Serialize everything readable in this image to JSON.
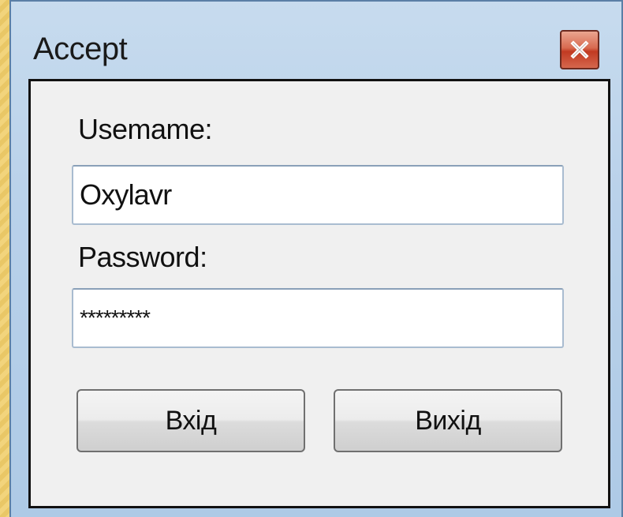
{
  "window": {
    "title": "Accept",
    "close_icon": "close-x-icon"
  },
  "form": {
    "username_label": "Usemame:",
    "username_value": "Oxylavr",
    "password_label": "Password:",
    "password_value": "*********"
  },
  "buttons": {
    "login_label": "Вхід",
    "exit_label": "Вихід"
  },
  "colors": {
    "titlebar": "#b9d1ea",
    "close_button": "#c13a22",
    "client_background": "#f0f0f0"
  }
}
